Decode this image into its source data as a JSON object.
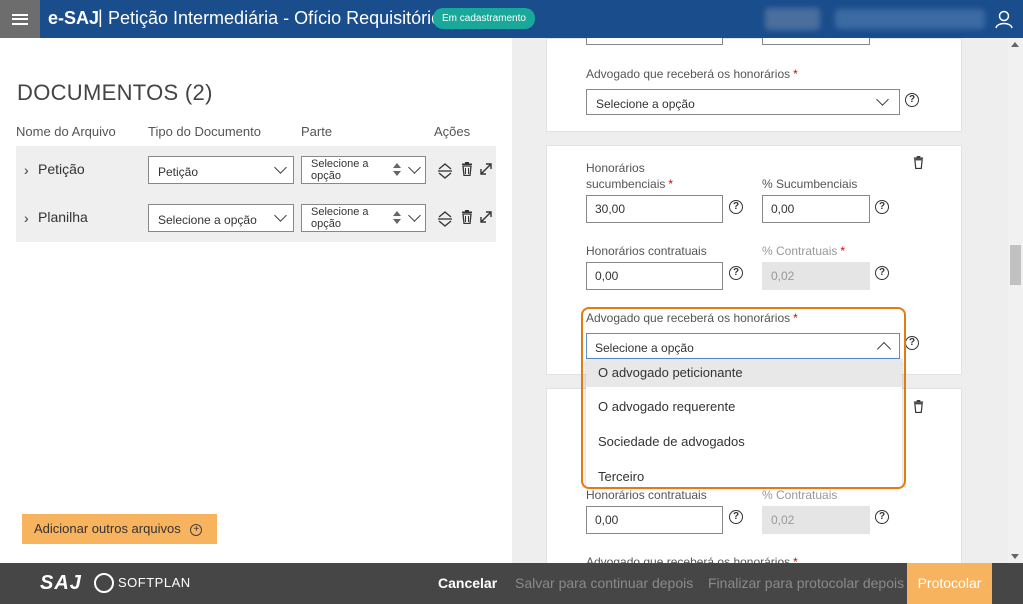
{
  "header": {
    "app_name": "e-SAJ",
    "separator": "|",
    "page_title": "Petição Intermediária - Ofício Requisitório",
    "status_badge": "Em cadastramento"
  },
  "documents": {
    "title": "DOCUMENTOS (2)",
    "columns": [
      "Nome do Arquivo",
      "Tipo do Documento",
      "Parte",
      "Ações"
    ],
    "rows": [
      {
        "name": "Petição",
        "type": "Petição",
        "parte": "Selecione a opção"
      },
      {
        "name": "Planilha",
        "type": "Selecione a opção",
        "parte": "Selecione a opção"
      }
    ],
    "add_button": "Adicionar outros arquivos"
  },
  "form": {
    "card1": {
      "advogado_label": "Advogado que receberá os honorários",
      "advogado_value": "Selecione a opção"
    },
    "card2": {
      "hon_sucumb_label_1": "Honorários",
      "hon_sucumb_label_2": "sucumbenciais",
      "hon_sucumb_value": "30,00",
      "pct_sucumb_label": "% Sucumbenciais",
      "pct_sucumb_value": "0,00",
      "hon_contrat_label": "Honorários contratuais",
      "hon_contrat_value": "0,00",
      "pct_contrat_label": "% Contratuais",
      "pct_contrat_value": "0,02",
      "advogado_label": "Advogado que receberá os honorários",
      "advogado_value": "Selecione a opção"
    },
    "card3": {
      "hon_contrat_label": "Honorários contratuais",
      "hon_contrat_value": "0,00",
      "pct_contrat_label": "% Contratuais",
      "pct_contrat_value": "0,02",
      "advogado_label": "Advogado que receberá os honorários"
    },
    "dropdown_options": [
      "O advogado peticionante",
      "O advogado requerente",
      "Sociedade de advogados",
      "Terceiro"
    ],
    "required_mark": "*",
    "help_glyph": "?"
  },
  "footer": {
    "logo_saj": "SAJ",
    "logo_softplan": "SOFTPLAN",
    "cancel": "Cancelar",
    "save_later": "Salvar para continuar depois",
    "finalize_later": "Finalizar para protocolar depois",
    "protocol": "Protocolar"
  },
  "colors": {
    "header_bg": "#1a4d8c",
    "badge": "#1aa89a",
    "accent_orange": "#f8b35e",
    "highlight_outline": "#e07d10",
    "footer_bg": "#464646"
  }
}
